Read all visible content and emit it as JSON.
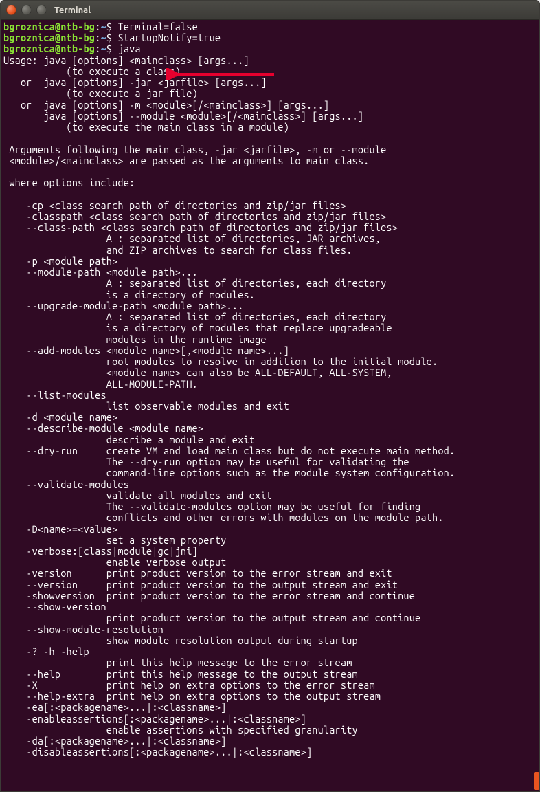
{
  "window": {
    "title": "Terminal"
  },
  "prompt": {
    "user": "bgroznica",
    "host": "ntb-bg",
    "path": "~",
    "sep_at": "@",
    "sep_colon": ":",
    "dollar": "$"
  },
  "commands": {
    "c1": "Terminal=false",
    "c2": "StartupNotify=true",
    "c3": "java"
  },
  "out": {
    "l01": "Usage: java [options] <mainclass> [args...]",
    "l02": "           (to execute a class)",
    "l03": "   or  java [options] -jar <jarfile> [args...]",
    "l04": "           (to execute a jar file)",
    "l05": "   or  java [options] -m <module>[/<mainclass>] [args...]",
    "l06": "       java [options] --module <module>[/<mainclass>] [args...]",
    "l07": "           (to execute the main class in a module)",
    "l08": "",
    "l09": " Arguments following the main class, -jar <jarfile>, -m or --module",
    "l10": " <module>/<mainclass> are passed as the arguments to main class.",
    "l11": "",
    "l12": " where options include:",
    "l13": "",
    "l14": "    -cp <class search path of directories and zip/jar files>",
    "l15": "    -classpath <class search path of directories and zip/jar files>",
    "l16": "    --class-path <class search path of directories and zip/jar files>",
    "l17": "                  A : separated list of directories, JAR archives,",
    "l18": "                  and ZIP archives to search for class files.",
    "l19": "    -p <module path>",
    "l20": "    --module-path <module path>...",
    "l21": "                  A : separated list of directories, each directory",
    "l22": "                  is a directory of modules.",
    "l23": "    --upgrade-module-path <module path>...",
    "l24": "                  A : separated list of directories, each directory",
    "l25": "                  is a directory of modules that replace upgradeable",
    "l26": "                  modules in the runtime image",
    "l27": "    --add-modules <module name>[,<module name>...]",
    "l28": "                  root modules to resolve in addition to the initial module.",
    "l29": "                  <module name> can also be ALL-DEFAULT, ALL-SYSTEM,",
    "l30": "                  ALL-MODULE-PATH.",
    "l31": "    --list-modules",
    "l32": "                  list observable modules and exit",
    "l33": "    -d <module name>",
    "l34": "    --describe-module <module name>",
    "l35": "                  describe a module and exit",
    "l36": "    --dry-run     create VM and load main class but do not execute main method.",
    "l37": "                  The --dry-run option may be useful for validating the",
    "l38": "                  command-line options such as the module system configuration.",
    "l39": "    --validate-modules",
    "l40": "                  validate all modules and exit",
    "l41": "                  The --validate-modules option may be useful for finding",
    "l42": "                  conflicts and other errors with modules on the module path.",
    "l43": "    -D<name>=<value>",
    "l44": "                  set a system property",
    "l45": "    -verbose:[class|module|gc|jni]",
    "l46": "                  enable verbose output",
    "l47": "    -version      print product version to the error stream and exit",
    "l48": "    --version     print product version to the output stream and exit",
    "l49": "    -showversion  print product version to the error stream and continue",
    "l50": "    --show-version",
    "l51": "                  print product version to the output stream and continue",
    "l52": "    --show-module-resolution",
    "l53": "                  show module resolution output during startup",
    "l54": "    -? -h -help",
    "l55": "                  print this help message to the error stream",
    "l56": "    --help        print this help message to the output stream",
    "l57": "    -X            print help on extra options to the error stream",
    "l58": "    --help-extra  print help on extra options to the output stream",
    "l59": "    -ea[:<packagename>...|:<classname>]",
    "l60": "    -enableassertions[:<packagename>...|:<classname>]",
    "l61": "                  enable assertions with specified granularity",
    "l62": "    -da[:<packagename>...|:<classname>]",
    "l63": "    -disableassertions[:<packagename>...|:<classname>]"
  },
  "colors": {
    "arrow": "#e6002e",
    "scrollbar": "#e95420"
  }
}
